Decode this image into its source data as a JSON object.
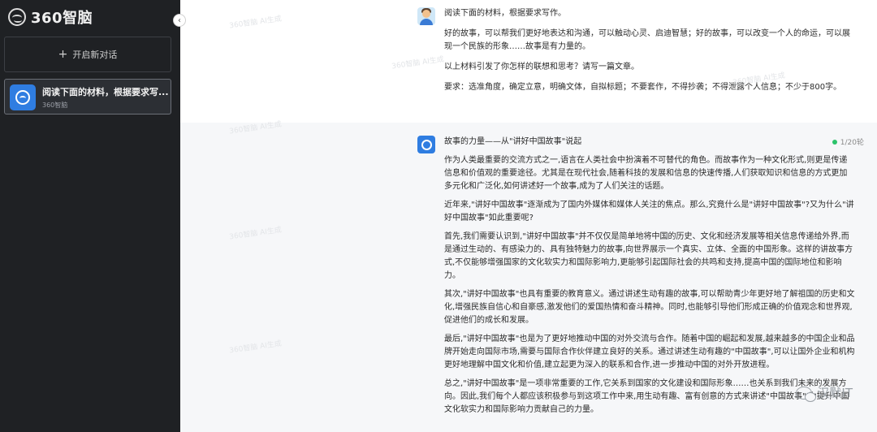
{
  "sidebar": {
    "brand": "360智脑",
    "new_chat_label": "开启新对话",
    "history": [
      {
        "title": "阅读下面的材料，根据要求写...",
        "subtitle": "360智脑"
      }
    ]
  },
  "user_message": {
    "paragraphs": [
      "阅读下面的材料，根据要求写作。",
      "好的故事，可以帮我们更好地表达和沟通，可以触动心灵、启迪智慧；好的故事，可以改变一个人的命运，可以展现一个民族的形象……故事是有力量的。",
      "以上材料引发了你怎样的联想和思考？请写一篇文章。",
      "要求：选准角度，确定立意，明确文体，自拟标题；不要套作，不得抄袭；不得泄露个人信息；不少于800字。"
    ]
  },
  "ai_message": {
    "counter": "1/20轮",
    "paragraphs": [
      "故事的力量——从\"讲好中国故事\"说起",
      "作为人类最重要的交流方式之一,语言在人类社会中扮演着不可替代的角色。而故事作为一种文化形式,则更是传递信息和价值观的重要途径。尤其是在现代社会,随着科技的发展和信息的快速传播,人们获取知识和信息的方式更加多元化和广泛化,如何讲述好一个故事,成为了人们关注的话题。",
      "近年来,\"讲好中国故事\"逐渐成为了国内外媒体和媒体人关注的焦点。那么,究竟什么是\"讲好中国故事\"?又为什么\"讲好中国故事\"如此重要呢?",
      "首先,我们需要认识到,\"讲好中国故事\"并不仅仅是简单地将中国的历史、文化和经济发展等相关信息传递给外界,而是通过生动的、有感染力的、具有独特魅力的故事,向世界展示一个真实、立体、全面的中国形象。这样的讲故事方式,不仅能够增强国家的文化软实力和国际影响力,更能够引起国际社会的共鸣和支持,提高中国的国际地位和影响力。",
      "其次,\"讲好中国故事\"也具有重要的教育意义。通过讲述生动有趣的故事,可以帮助青少年更好地了解祖国的历史和文化,增强民族自信心和自豪感,激发他们的爱国热情和奋斗精神。同时,也能够引导他们形成正确的价值观念和世界观,促进他们的成长和发展。",
      "最后,\"讲好中国故事\"也是为了更好地推动中国的对外交流与合作。随着中国的崛起和发展,越来越多的中国企业和品牌开始走向国际市场,需要与国际合作伙伴建立良好的关系。通过讲述生动有趣的\"中国故事\",可以让国外企业和机构更好地理解中国文化和价值,建立起更为深入的联系和合作,进一步推动中国的对外开放进程。",
      "总之,\"讲好中国故事\"是一项非常重要的工作,它关系到国家的文化建设和国际形象……也关系到我们未来的发展方向。因此,我们每个人都应该积极参与到这项工作中来,用生动有趣、富有创意的方式来讲述\"中国故事\",为提升中国文化软实力和国际影响力贡献自己的力量。"
    ]
  },
  "watermark_text": "360智脑 AI生成",
  "corner_mark": "汉默IT"
}
